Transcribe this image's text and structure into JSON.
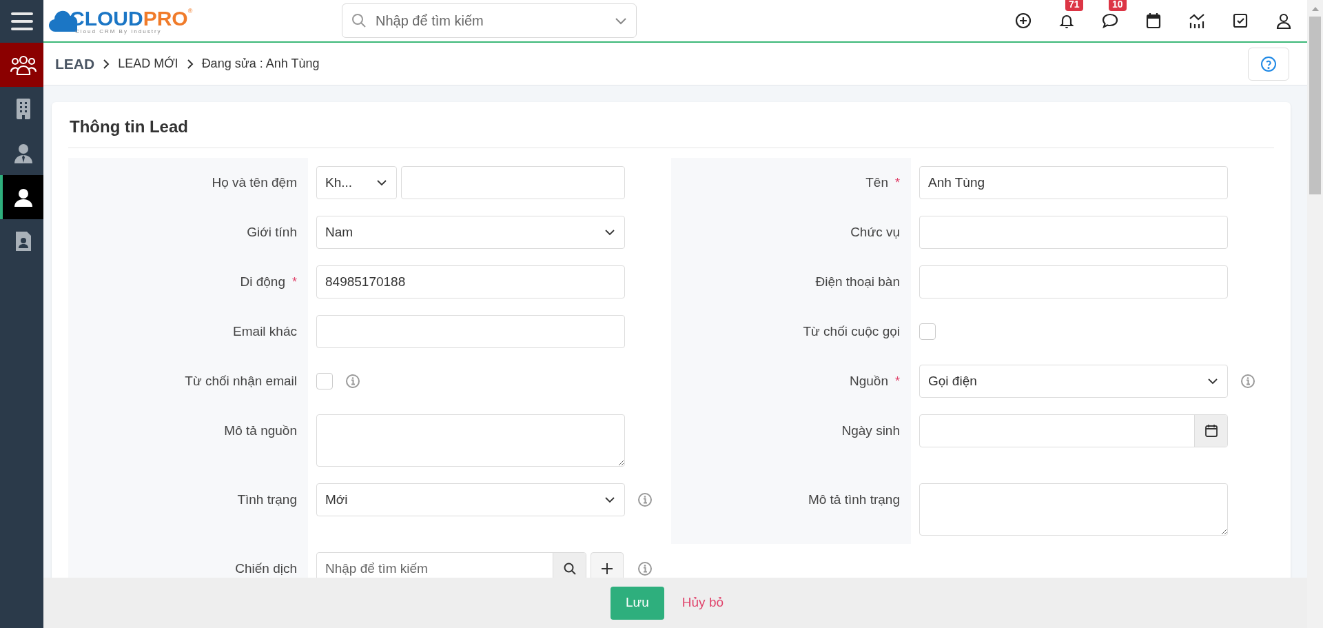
{
  "sidebar": {
    "items": [
      {
        "kind": "group",
        "accent": true,
        "selected": false
      },
      {
        "kind": "building",
        "accent": false,
        "selected": false
      },
      {
        "kind": "agent",
        "accent": false,
        "selected": false
      },
      {
        "kind": "person",
        "accent": false,
        "selected": true
      },
      {
        "kind": "contact",
        "accent": false,
        "selected": false
      }
    ]
  },
  "logo": {
    "first": "CLOUD",
    "second": "PRO",
    "mark": "®",
    "tagline": "Cloud CRM By Industry"
  },
  "search": {
    "placeholder": "Nhập để tìm kiếm"
  },
  "toolbar": [
    {
      "kind": "add"
    },
    {
      "kind": "bell",
      "badge": "71"
    },
    {
      "kind": "chat",
      "badge": "10"
    },
    {
      "kind": "calendar"
    },
    {
      "kind": "chart"
    },
    {
      "kind": "task"
    },
    {
      "kind": "user"
    }
  ],
  "breadcrumb": [
    "LEAD",
    "LEAD MỚI",
    "Đang sửa : Anh Tùng"
  ],
  "form": {
    "title": "Thông tin Lead",
    "left_fields": [
      {
        "kind": "name",
        "label": "Họ và tên đệm",
        "prefix": "Kh...",
        "info": false
      },
      {
        "kind": "select",
        "label": "Giới tính",
        "value": "Nam",
        "info": false
      },
      {
        "kind": "text",
        "label": "Di động",
        "required_mark": "*",
        "value": "84985170188",
        "info": false
      },
      {
        "kind": "text",
        "label": "Email khác",
        "info": false
      },
      {
        "kind": "checkbox",
        "label": "Từ chối nhận email",
        "checked": false,
        "info": true
      },
      {
        "kind": "textarea",
        "label": "Mô tả nguồn",
        "info": false
      },
      {
        "kind": "select",
        "label": "Tình trạng",
        "value": "Mới",
        "info": true
      },
      {
        "kind": "lookup",
        "label": "Chiến dịch",
        "placeholder": "Nhập để tìm kiếm",
        "info": true
      }
    ],
    "right_fields": [
      {
        "kind": "text",
        "label": "Tên",
        "required_mark": "*",
        "value": "Anh Tùng",
        "info": false
      },
      {
        "kind": "text",
        "label": "Chức vụ",
        "info": false
      },
      {
        "kind": "text",
        "label": "Điện thoại bàn",
        "info": false
      },
      {
        "kind": "checkbox",
        "label": "Từ chối cuộc gọi",
        "checked": false,
        "info": false
      },
      {
        "kind": "select",
        "label": "Nguồn",
        "required_mark": "*",
        "value": "Gọi điện",
        "info": true
      },
      {
        "kind": "date",
        "label": "Ngày sinh",
        "info": false
      },
      {
        "kind": "textarea",
        "label": "Mô tả tình trạng",
        "info": false
      }
    ]
  },
  "footer": {
    "save": "Lưu",
    "cancel": "Hủy bỏ"
  }
}
